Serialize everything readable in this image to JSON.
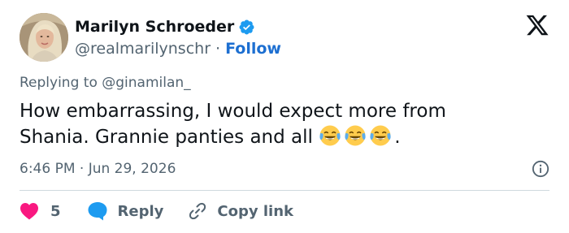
{
  "author": {
    "display_name": "Marilyn Schroeder",
    "handle": "@realmarilynschr",
    "separator": "·",
    "follow_label": "Follow",
    "verified": true
  },
  "reply_context": {
    "prefix": "Replying to ",
    "mention": "@ginamilan_"
  },
  "tweet": {
    "text_line1": "How embarrassing, I would expect more from",
    "text_line2": "Shania. Grannie panties and all",
    "emojis": [
      "face-with-tears-of-joy",
      "face-with-tears-of-joy",
      "face-with-tears-of-joy"
    ],
    "trailing": "."
  },
  "timestamp": "6:46 PM · Jun 29, 2026",
  "actions": {
    "like_count": "5",
    "reply_label": "Reply",
    "copy_label": "Copy link"
  },
  "icons": {
    "verified": "verified-badge-icon",
    "platform": "x-logo-icon",
    "info": "info-icon",
    "like": "heart-icon",
    "reply": "speech-bubble-icon",
    "copy": "link-icon"
  },
  "colors": {
    "text": "#0f1419",
    "secondary": "#536471",
    "link": "#1d6fd1",
    "verified": "#1d9bf0",
    "heart": "#f91880",
    "reply": "#1d9bf0",
    "divider": "#cfd9de"
  }
}
